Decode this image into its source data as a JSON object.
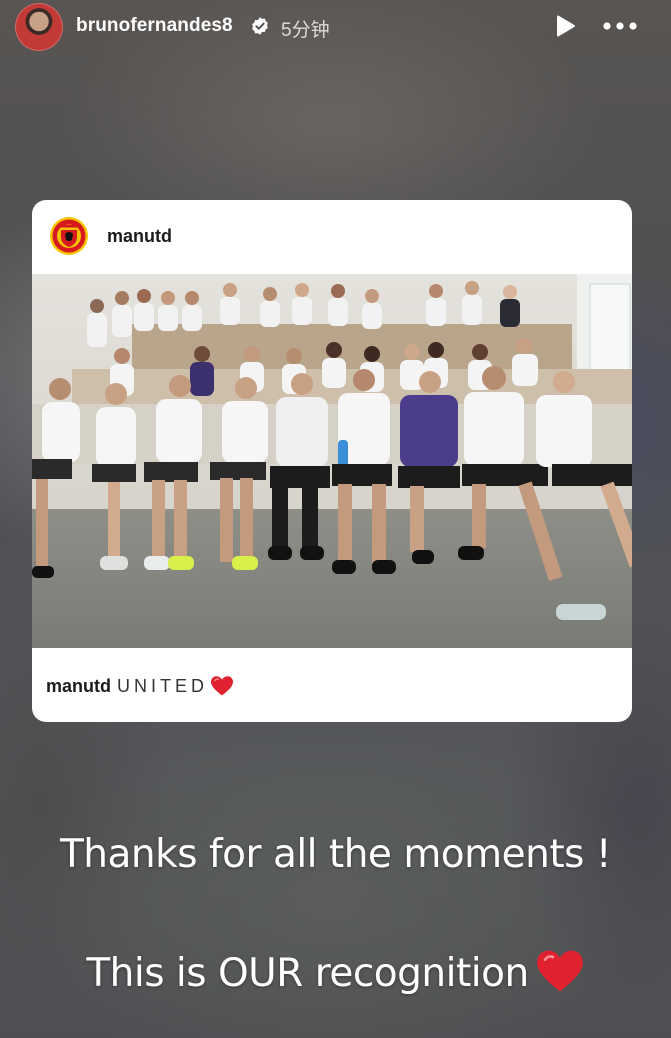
{
  "story": {
    "username": "brunofernandes8",
    "time_ago": "5分钟",
    "verified": true,
    "play_icon": "play-icon",
    "more_icon": "more-icon"
  },
  "shared_post": {
    "username": "manutd",
    "logo_icon": "manutd-crest",
    "caption_user": "manutd",
    "caption_text": "UNITED",
    "caption_emoji": "red-heart"
  },
  "overlay_text": {
    "line1": "Thanks for all the moments !",
    "line2": "This is OUR recognition"
  },
  "colors": {
    "heart": "#e0212f",
    "verified": "#ffffff",
    "crest_red": "#d71920",
    "crest_gold": "#f5c400"
  }
}
